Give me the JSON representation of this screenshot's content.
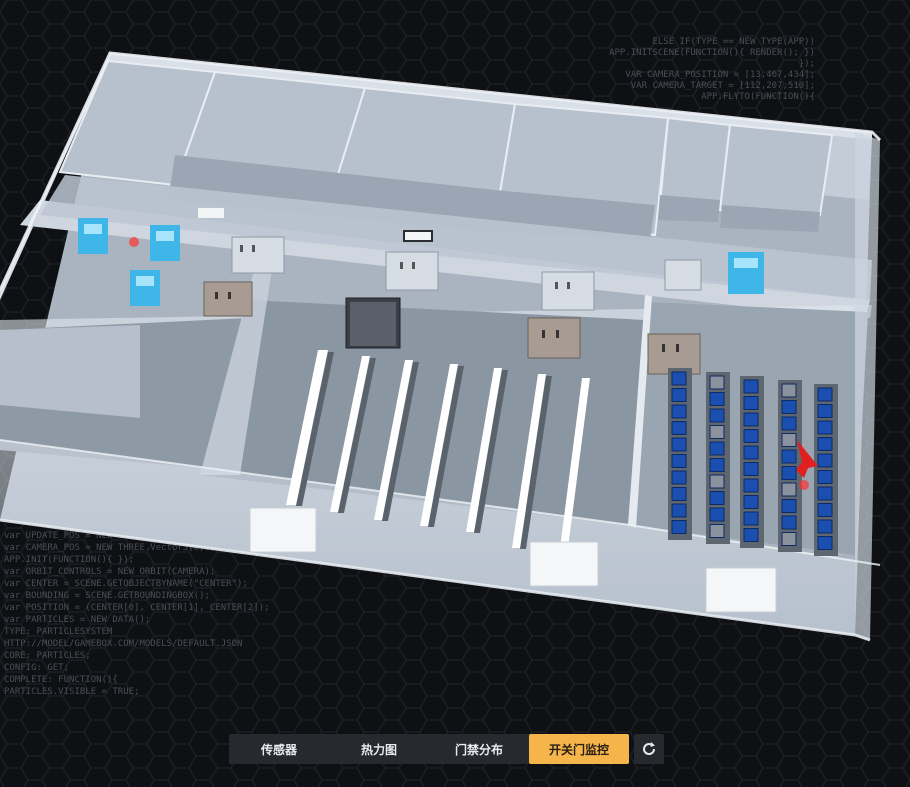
{
  "toolbar": {
    "tabs": [
      {
        "label": "传感器"
      },
      {
        "label": "热力图"
      },
      {
        "label": "门禁分布"
      },
      {
        "label": "开关门监控"
      }
    ],
    "active_index": 3
  },
  "icons": {
    "refresh": "refresh-icon",
    "alarm": "alarm-marker-icon"
  },
  "colors": {
    "active_tab": "#f5b54b",
    "alarm": "#e02020",
    "rack_blue": "#1a4fb0",
    "door_cyan": "#3fb6e8"
  },
  "background_code": [
    "var UPDATE_POS = NEW THREE.Vector3();",
    "var CAMERA_POS = NEW THREE.Vector3(0,0,0);",
    "APP.INIT(FUNCTION(){ });",
    "var ORBIT_CONTROLS = NEW ORBIT(CAMERA);",
    "var CENTER = SCENE.GETOBJECTBYNAME(\"CENTER\");",
    "var BOUNDING = SCENE.GETBOUNDINGBOX();",
    "var POSITION = (CENTER[0], CENTER[1], CENTER[2]);",
    "var PARTICLES = NEW DATA();",
    "  TYPE: PARTICLESYSTEM",
    "HTTP://MODEL/GAMEBOX.COM/MODELS/DEFAULT.JSON",
    "  CORE: PARTICLES;",
    "    CONFIG: GET;",
    "    COMPLETE: FUNCTION(){",
    "      PARTICLES.VISIBLE = TRUE;"
  ],
  "background_code_top": [
    "ELSE IF(TYPE == NEW TYPE(APP))",
    "APP.INITSCENE(FUNCTION(){ RENDER(); })",
    "});",
    "VAR CAMERA_POSITION = [13,467,434];",
    "VAR CAMERA_TARGET = [112,207,510];",
    "APP.FLYTO(FUNCTION(){"
  ]
}
